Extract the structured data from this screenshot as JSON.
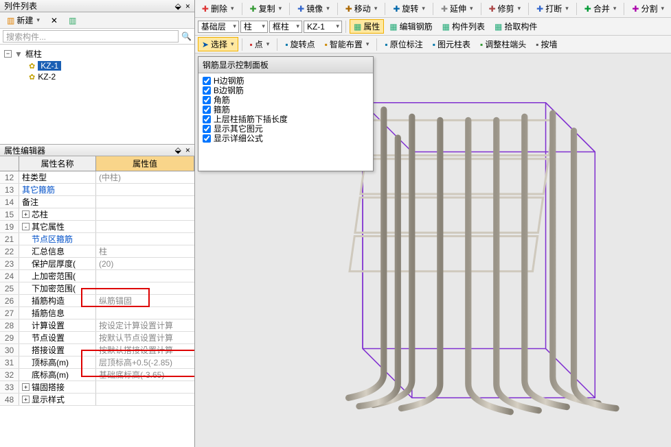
{
  "left": {
    "listTitle": "列件列表",
    "newBtn": "新建",
    "searchPlaceholder": "搜索构件...",
    "tree": {
      "root": "框柱",
      "items": [
        "KZ-1",
        "KZ-2"
      ]
    }
  },
  "propEditor": {
    "title": "属性编辑器",
    "headName": "属性名称",
    "headVal": "属性值",
    "rows": [
      {
        "n": "12",
        "name": "柱类型",
        "val": "(中柱)"
      },
      {
        "n": "13",
        "name": "其它箍筋",
        "val": "",
        "link": true
      },
      {
        "n": "14",
        "name": "备注",
        "val": ""
      },
      {
        "n": "15",
        "name": "芯柱",
        "val": "",
        "exp": "+"
      },
      {
        "n": "19",
        "name": "其它属性",
        "val": "",
        "exp": "-"
      },
      {
        "n": "21",
        "name": "节点区箍筋",
        "val": "",
        "link": true,
        "indent": true
      },
      {
        "n": "22",
        "name": "汇总信息",
        "val": "柱",
        "indent": true
      },
      {
        "n": "23",
        "name": "保护层厚度(",
        "val": "(20)",
        "indent": true
      },
      {
        "n": "24",
        "name": "上加密范围(",
        "val": "",
        "indent": true
      },
      {
        "n": "25",
        "name": "下加密范围(",
        "val": "",
        "indent": true
      },
      {
        "n": "26",
        "name": "插筋构造",
        "val": "纵筋锚固",
        "indent": true
      },
      {
        "n": "27",
        "name": "插筋信息",
        "val": "",
        "indent": true
      },
      {
        "n": "28",
        "name": "计算设置",
        "val": "按设定计算设置计算",
        "indent": true
      },
      {
        "n": "29",
        "name": "节点设置",
        "val": "按默认节点设置计算",
        "indent": true
      },
      {
        "n": "30",
        "name": "搭接设置",
        "val": "按默认搭接设置计算",
        "indent": true
      },
      {
        "n": "31",
        "name": "顶标高(m)",
        "val": "层顶标高+0.5(-2.85)",
        "indent": true
      },
      {
        "n": "32",
        "name": "底标高(m)",
        "val": "基础底标高(-3.65)",
        "indent": true
      },
      {
        "n": "33",
        "name": "锚固搭接",
        "val": "",
        "exp": "+"
      },
      {
        "n": "48",
        "name": "显示样式",
        "val": "",
        "exp": "+"
      }
    ]
  },
  "topToolbar": {
    "items": [
      "删除",
      "复制",
      "镜像",
      "移动",
      "旋转",
      "延伸",
      "修剪",
      "打断",
      "合并",
      "分割"
    ]
  },
  "toolbar2": {
    "combos": [
      "基础层",
      "柱",
      "框柱",
      "KZ-1"
    ],
    "btns": [
      "属性",
      "编辑钢筋",
      "构件列表",
      "拾取构件"
    ]
  },
  "toolbar3": {
    "select": "选择",
    "btns": [
      "点",
      "旋转点",
      "智能布置",
      "原位标注",
      "图元柱表",
      "调整柱端头",
      "按墙"
    ]
  },
  "floatPanel": {
    "title": "钢筋显示控制面板",
    "checks": [
      "H边钢筋",
      "B边钢筋",
      "角筋",
      "箍筋",
      "上层柱插筋下插长度",
      "显示其它图元",
      "显示详细公式"
    ]
  }
}
